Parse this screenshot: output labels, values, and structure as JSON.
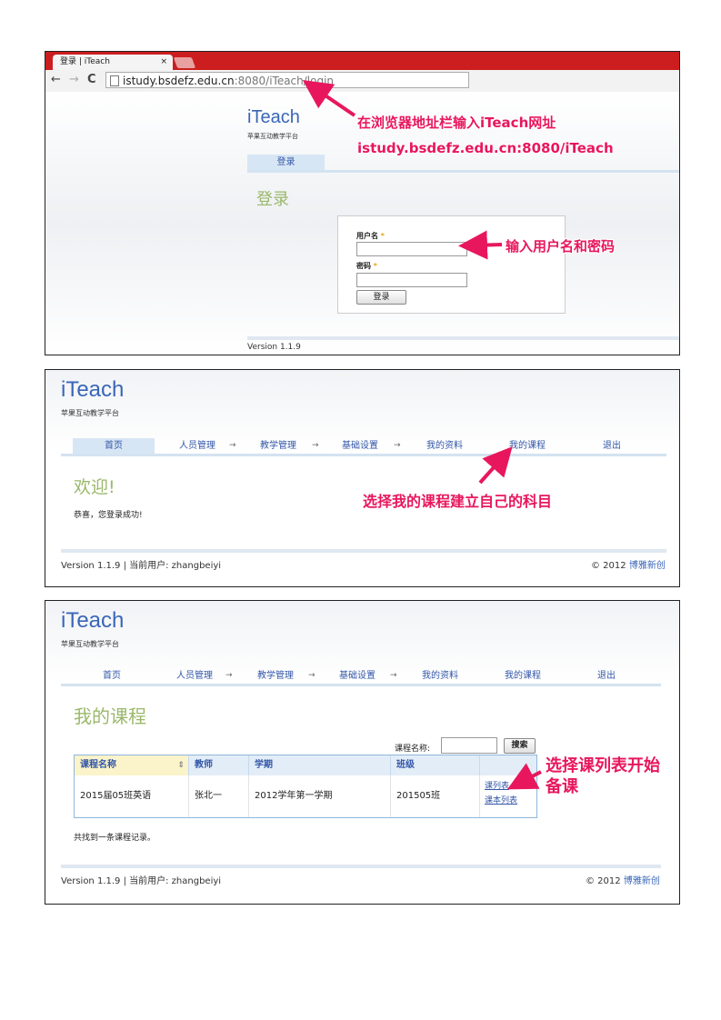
{
  "panel1": {
    "tab_title": "登录 | iTeach",
    "tab_close": "×",
    "nav_back": "←",
    "nav_forward": "→",
    "nav_reload": "C",
    "url_host": "istudy.bsdefz.edu.cn",
    "url_rest": ":8080/iTeach/login",
    "brand": "iTeach",
    "subtitle": "苹果互动教学平台",
    "login_tab": "登录",
    "heading": "登录",
    "username_label": "用户名",
    "password_label": "密码",
    "required_mark": "*",
    "login_button": "登录",
    "version": "Version 1.1.9",
    "callout_url_1": "在浏览器地址栏输入iTeach网址",
    "callout_url_2": "istudy.bsdefz.edu.cn:8080/iTeach",
    "callout_credentials": "输入用户名和密码"
  },
  "nav": {
    "items": [
      "首页",
      "人员管理",
      "教学管理",
      "基础设置",
      "我的资料",
      "我的课程",
      "退出"
    ],
    "arrow": "→"
  },
  "panel2": {
    "brand": "iTeach",
    "subtitle": "苹果互动教学平台",
    "heading": "欢迎!",
    "message": "恭喜，您登录成功!",
    "callout": "选择我的课程建立自己的科目",
    "footer_left": "Version 1.1.9 | 当前用户: zhangbeiyi",
    "footer_copy": "© 2012",
    "footer_company": "博雅新创"
  },
  "panel3": {
    "brand": "iTeach",
    "subtitle": "苹果互动教学平台",
    "heading": "我的课程",
    "search_label": "课程名称:",
    "search_value": "",
    "search_button": "搜索",
    "table": {
      "headers": [
        "课程名称",
        "教师",
        "学期",
        "班级",
        ""
      ],
      "sort_icon": "⇕",
      "row": {
        "course": "2015届05班英语",
        "teacher": "张北一",
        "term": "2012学年第一学期",
        "class": "201505班",
        "link1": "课列表",
        "link2": "课本列表"
      }
    },
    "record_count": "共找到一条课程记录。",
    "callout_1": "选择课列表开始",
    "callout_2": "备课",
    "footer_left": "Version 1.1.9 | 当前用户: zhangbeiyi",
    "footer_copy": "© 2012",
    "footer_company": "博雅新创"
  },
  "colors": {
    "callout": "#e8175d",
    "brand_blue": "#3a66b8",
    "heading_green": "#9ab86b",
    "tab_red": "#cc1e1e"
  }
}
